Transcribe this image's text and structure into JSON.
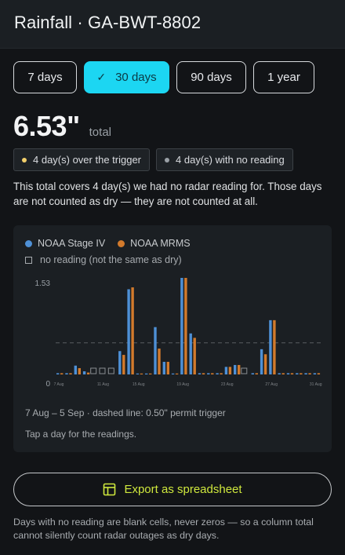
{
  "header": {
    "title": "Rainfall · GA-BWT-8802"
  },
  "ranges": [
    {
      "label": "7 days",
      "selected": false
    },
    {
      "label": "30 days",
      "selected": true
    },
    {
      "label": "90 days",
      "selected": false
    },
    {
      "label": "1 year",
      "selected": false
    }
  ],
  "total": {
    "value": "6.53\"",
    "label": "total"
  },
  "badges": [
    {
      "text": "4 day(s) over the trigger",
      "color": "#f2cf6b"
    },
    {
      "text": "4 day(s) with no reading",
      "color": "#9aa0a6"
    }
  ],
  "note": "This total covers 4 day(s) we had no radar reading for. Those days are not counted as dry — they are not counted at all.",
  "legend": {
    "series": [
      {
        "name": "NOAA Stage IV",
        "color": "#4e90d6"
      },
      {
        "name": "NOAA MRMS",
        "color": "#d27a2c"
      }
    ],
    "no_reading": "no reading (not the same as dry)"
  },
  "chart_data": {
    "type": "bar",
    "ylim": [
      0,
      1.53
    ],
    "y_ticks": [
      "1.53",
      "0"
    ],
    "trigger": 0.5,
    "x_ticks": [
      {
        "index": 0,
        "label": "7 Aug"
      },
      {
        "index": 5,
        "label": "11 Aug"
      },
      {
        "index": 9,
        "label": "15 Aug"
      },
      {
        "index": 14,
        "label": "19 Aug"
      },
      {
        "index": 19,
        "label": "23 Aug"
      },
      {
        "index": 24,
        "label": "27 Aug"
      },
      {
        "index": 29,
        "label": "31 Aug"
      }
    ],
    "categories": [
      "7 Aug",
      "8 Aug",
      "9 Aug",
      "10 Aug",
      "11 Aug",
      "12 Aug",
      "13 Aug",
      "14 Aug",
      "15 Aug",
      "16 Aug",
      "17 Aug",
      "18 Aug",
      "19 Aug",
      "20 Aug",
      "21 Aug",
      "22 Aug",
      "23 Aug",
      "24 Aug",
      "25 Aug",
      "26 Aug",
      "27 Aug",
      "28 Aug",
      "29 Aug",
      "30 Aug",
      "31 Aug",
      "1 Sep",
      "2 Sep",
      "3 Sep",
      "4 Sep",
      "5 Sep"
    ],
    "series": [
      {
        "name": "NOAA Stage IV",
        "color": "#4e90d6",
        "values": [
          0.02,
          0.02,
          0.14,
          0.05,
          null,
          null,
          null,
          0.37,
          1.35,
          0.01,
          0.01,
          0.75,
          0.2,
          0.01,
          1.53,
          0.65,
          0.02,
          0.02,
          0.02,
          0.12,
          0.15,
          null,
          0.02,
          0.4,
          0.86,
          0.02,
          0.02,
          0.02,
          0.02,
          0.02
        ],
        "no_reading": [
          false,
          false,
          false,
          false,
          true,
          true,
          true,
          false,
          false,
          false,
          false,
          false,
          false,
          false,
          false,
          false,
          false,
          false,
          false,
          false,
          false,
          true,
          false,
          false,
          false,
          false,
          false,
          false,
          false,
          false
        ]
      },
      {
        "name": "NOAA MRMS",
        "color": "#d27a2c",
        "values": [
          0.02,
          0.02,
          0.1,
          0.03,
          null,
          null,
          null,
          0.31,
          1.38,
          0.01,
          0.01,
          0.41,
          0.2,
          0.01,
          1.53,
          0.58,
          0.02,
          0.02,
          0.02,
          0.12,
          0.15,
          null,
          0.02,
          0.32,
          0.86,
          0.02,
          0.02,
          0.02,
          0.02,
          0.02
        ]
      }
    ]
  },
  "caption": "7 Aug – 5 Sep · dashed line: 0.50\" permit trigger",
  "hint": "Tap a day for the readings.",
  "export": {
    "label": "Export as spreadsheet"
  },
  "footnote": "Days with no reading are blank cells, never zeros — so a column total cannot silently count radar outages as dry days."
}
